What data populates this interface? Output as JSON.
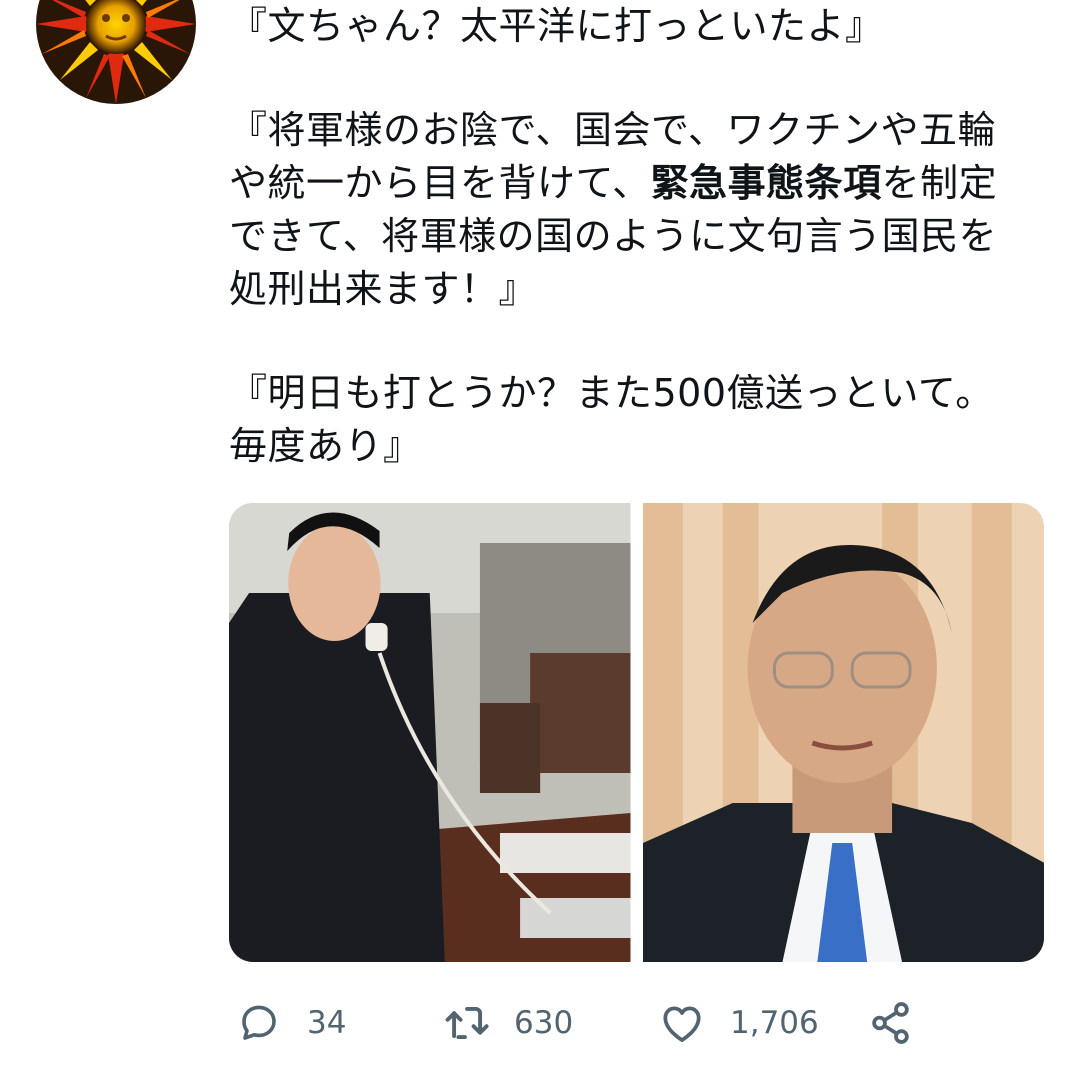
{
  "tweet": {
    "paragraphs": [
      {
        "segments": [
          {
            "text": "『文ちゃん？太平洋に打っといたよ』",
            "bold": false
          }
        ]
      },
      {
        "segments": [
          {
            "text": "『将軍様のお陰で、国会で、ワクチンや五輪や統一から目を背けて、",
            "bold": false
          },
          {
            "text": "緊急事態条項",
            "bold": true
          },
          {
            "text": "を制定できて、将軍様の国のように文句言う国民を処刑出来ます！』",
            "bold": false
          }
        ]
      },
      {
        "segments": [
          {
            "text": "『明日も打とうか？また500億送っといて。毎度あり』",
            "bold": false
          }
        ]
      }
    ],
    "lines": [
      [
        "『文ちゃん？太平洋に打っといたよ』"
      ],
      [],
      [
        "『将軍様のお陰で、国会で、ワクチンや五輪"
      ],
      [
        "や統一から目を背けて、",
        "緊急事態条項",
        "を制定"
      ],
      [
        "できて、将軍様の国のように文句言う国民を"
      ],
      [
        "処刑出来ます！』"
      ],
      [],
      [
        "『明日も打とうか？また500億送っといて。"
      ],
      [
        "毎度あり』"
      ]
    ]
  },
  "media": {
    "left_photo": "man-on-phone-photo",
    "right_photo": "man-in-suit-photo"
  },
  "actions": {
    "reply": {
      "icon": "reply-icon",
      "count": "34"
    },
    "retweet": {
      "icon": "retweet-icon",
      "count": "630"
    },
    "like": {
      "icon": "heart-icon",
      "count": "1,706"
    },
    "share": {
      "icon": "share-icon"
    }
  },
  "colors": {
    "text": "#0f1419",
    "muted": "#536471",
    "background": "#ffffff"
  }
}
